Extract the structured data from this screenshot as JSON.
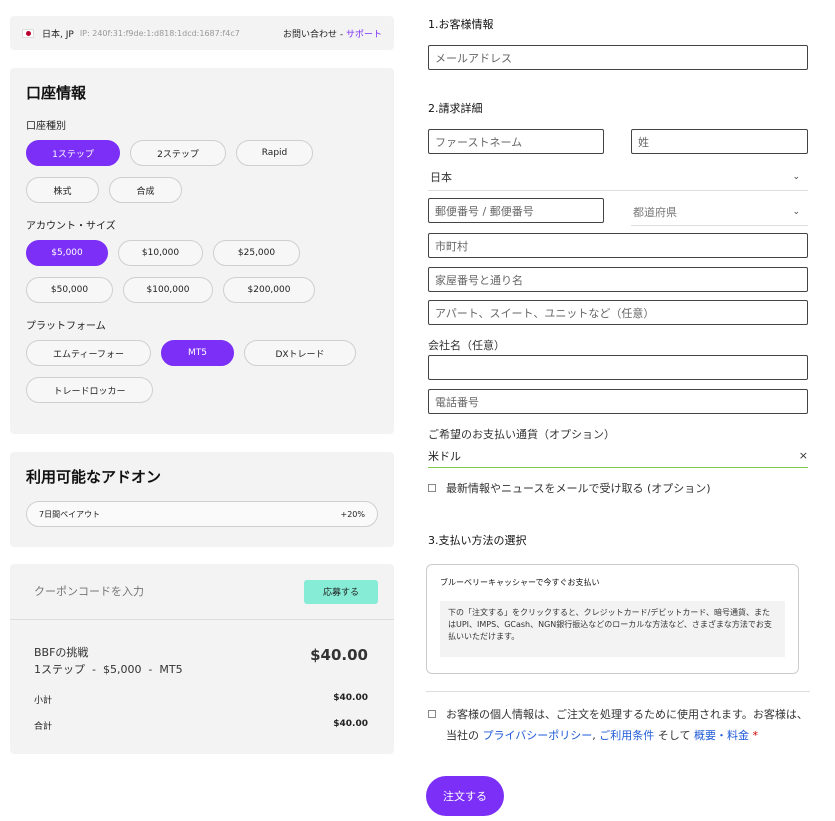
{
  "topbar": {
    "location": "日本, JP",
    "ip": "IP: 240f:31:f9de:1:d818:1dcd:1687:f4c7",
    "support_prefix": "お問い合わせ - ",
    "support_link": "サポート"
  },
  "account": {
    "title": "口座情報",
    "type_label": "口座種別",
    "types": [
      "1ステップ",
      "2ステップ",
      "Rapid",
      "株式",
      "合成"
    ],
    "size_label": "アカウント・サイズ",
    "sizes": [
      "$5,000",
      "$10,000",
      "$25,000",
      "$50,000",
      "$100,000",
      "$200,000"
    ],
    "platform_label": "プラットフォーム",
    "platforms": [
      "エムティーフォー",
      "MT5",
      "DXトレード",
      "トレードロッカー"
    ]
  },
  "addons": {
    "title": "利用可能なアドオン",
    "items": [
      {
        "name": "7日間ペイアウト",
        "value": "+20%"
      }
    ]
  },
  "summary": {
    "coupon_placeholder": "クーポンコードを入力",
    "apply_label": "応募する",
    "product_name": "BBFの挑戦",
    "product_detail": "1ステップ  -  $5,000  -  MT5",
    "product_price": "$40.00",
    "subtotal_label": "小計",
    "subtotal_value": "$40.00",
    "total_label": "合計",
    "total_value": "$40.00"
  },
  "customer": {
    "section_title": "1.お客様情報",
    "email_placeholder": "メールアドレス"
  },
  "billing": {
    "section_title": "2.請求詳細",
    "first_name_placeholder": "ファーストネーム",
    "last_name_placeholder": "姓",
    "country_value": "日本",
    "postal_placeholder": "郵便番号 / 郵便番号",
    "prefecture_placeholder": "都道府県",
    "city_placeholder": "市町村",
    "street_placeholder": "家屋番号と通り名",
    "apartment_placeholder": "アパート、スイート、ユニットなど（任意）",
    "company_label": "会社名（任意）",
    "phone_placeholder": "電話番号",
    "currency_label": "ご希望のお支払い通貨（オプション）",
    "currency_value": "米ドル",
    "currency_clear": "×",
    "newsletter_label": "最新情報やニュースをメールで受け取る (オプション)"
  },
  "payment": {
    "section_title": "3.支払い方法の選択",
    "method_title": "ブルーベリーキャッシャーで今すぐお支払い",
    "method_desc": "下の「注文する」をクリックすると、クレジットカード/デビットカード、暗号通貨、またはUPI、IMPS、GCash、NGN銀行振込などのローカルな方法など、さまざまな方法でお支払いいただけます。"
  },
  "privacy": {
    "text1": "お客様の個人情報は、ご注文を処理するために使用されます。お客様は、当社の",
    "link1": "プライバシーポリシー",
    "sep": ",",
    "link2": "ご利用条件",
    "text2": "そして",
    "link3": "概要・料金",
    "required": "*"
  },
  "order_button": "注文する",
  "colors": {
    "accent": "#7b2ff7",
    "apply": "#86ecd6",
    "link": "#1f5bd6"
  }
}
